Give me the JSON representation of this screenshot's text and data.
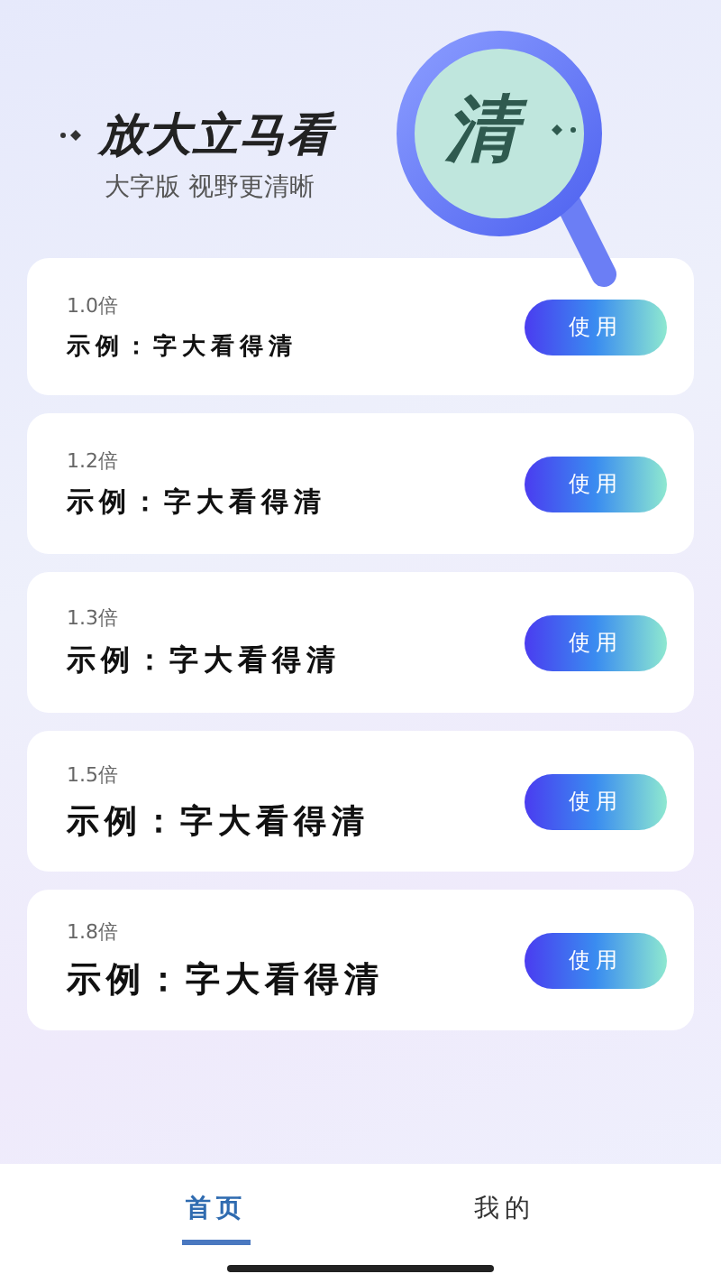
{
  "header": {
    "title": "放大立马看",
    "lens_text": "清",
    "subtitle": "大字版 视野更清晰"
  },
  "options": [
    {
      "scale": "1.0倍",
      "sample": "示例：字大看得清",
      "button": "使用"
    },
    {
      "scale": "1.2倍",
      "sample": "示例：字大看得清",
      "button": "使用"
    },
    {
      "scale": "1.3倍",
      "sample": "示例：字大看得清",
      "button": "使用"
    },
    {
      "scale": "1.5倍",
      "sample": "示例：字大看得清",
      "button": "使用"
    },
    {
      "scale": "1.8倍",
      "sample": "示例：字大看得清",
      "button": "使用"
    }
  ],
  "tabs": [
    {
      "label": "首页",
      "selected": true
    },
    {
      "label": "我的",
      "selected": false
    }
  ]
}
